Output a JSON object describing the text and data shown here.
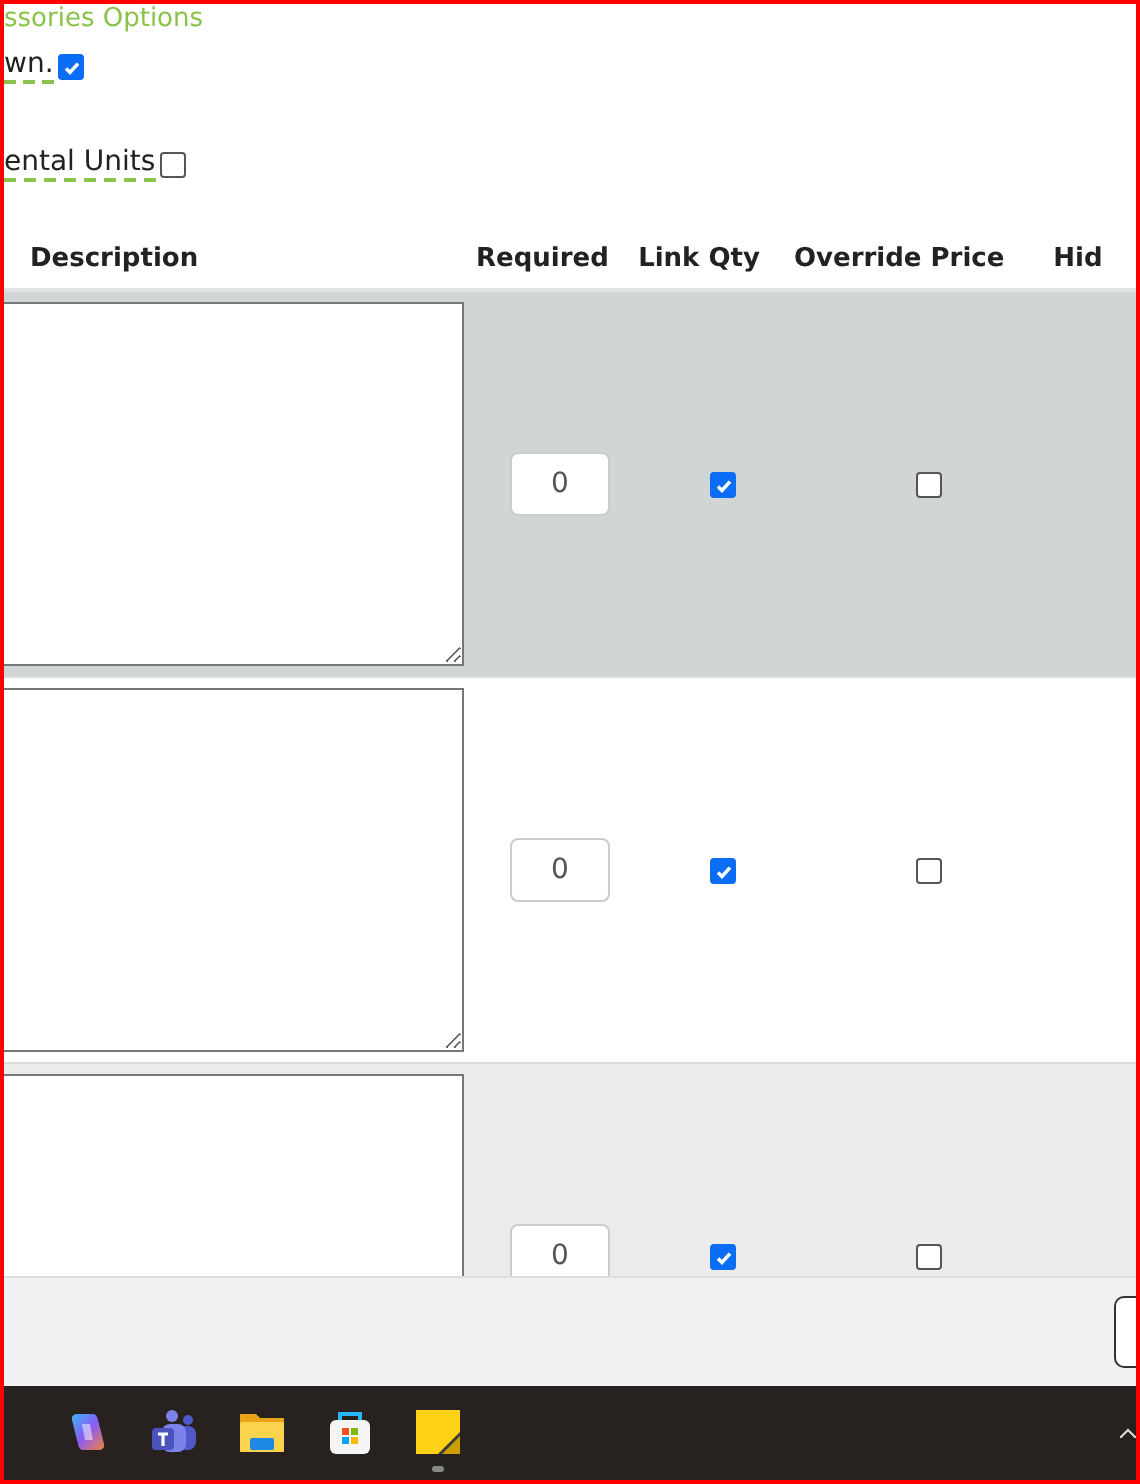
{
  "section_title": "ssories Options",
  "options": [
    {
      "label": "wn.",
      "checked": true
    },
    {
      "label": "ental Units",
      "checked": false
    }
  ],
  "table": {
    "columns": [
      "Description",
      "Required",
      "Link Qty",
      "Override Price",
      "Hid"
    ],
    "rows": [
      {
        "selected": true,
        "required": "0",
        "link_qty": true,
        "override_price": false
      },
      {
        "selected": false,
        "required": "0",
        "link_qty": true,
        "override_price": false
      },
      {
        "selected": false,
        "required": "0",
        "link_qty": true,
        "override_price": false
      }
    ]
  },
  "taskbar": {
    "apps": [
      {
        "kind": "copilot",
        "selected": false
      },
      {
        "kind": "teams",
        "selected": false
      },
      {
        "kind": "folder",
        "selected": false
      },
      {
        "kind": "store",
        "selected": false
      },
      {
        "kind": "notes",
        "selected": true
      }
    ]
  }
}
